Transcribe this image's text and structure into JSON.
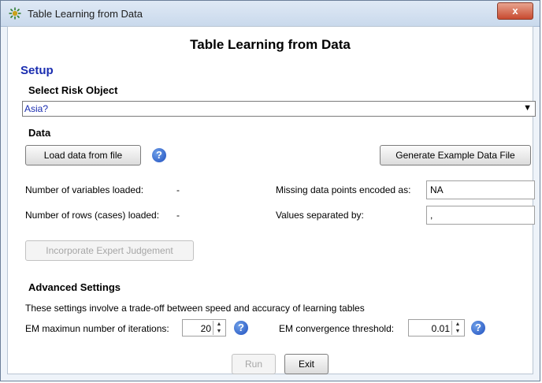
{
  "window": {
    "title": "Table Learning from Data",
    "close_label": "x"
  },
  "dialog": {
    "heading": "Table Learning from Data",
    "setup_label": "Setup",
    "select_risk_object": {
      "label": "Select Risk Object",
      "selected": "Asia?"
    },
    "data_section": {
      "label": "Data",
      "load_button": "Load data from file",
      "generate_button": "Generate Example Data File",
      "variables_loaded_label": "Number of variables loaded:",
      "variables_loaded_value": "-",
      "rows_loaded_label": "Number of rows (cases) loaded:",
      "rows_loaded_value": "-",
      "missing_label": "Missing data points encoded as:",
      "missing_value": "NA",
      "separator_label": "Values separated by:",
      "separator_value": ",",
      "expert_button": "Incorporate Expert Judgement"
    },
    "advanced": {
      "label": "Advanced Settings",
      "description": "These settings involve a trade-off between speed and accuracy of learning tables",
      "em_iterations_label": "EM maximun number of iterations:",
      "em_iterations_value": "20",
      "em_threshold_label": "EM convergence threshold:",
      "em_threshold_value": "0.01"
    },
    "footer": {
      "run_button": "Run",
      "exit_button": "Exit"
    }
  }
}
